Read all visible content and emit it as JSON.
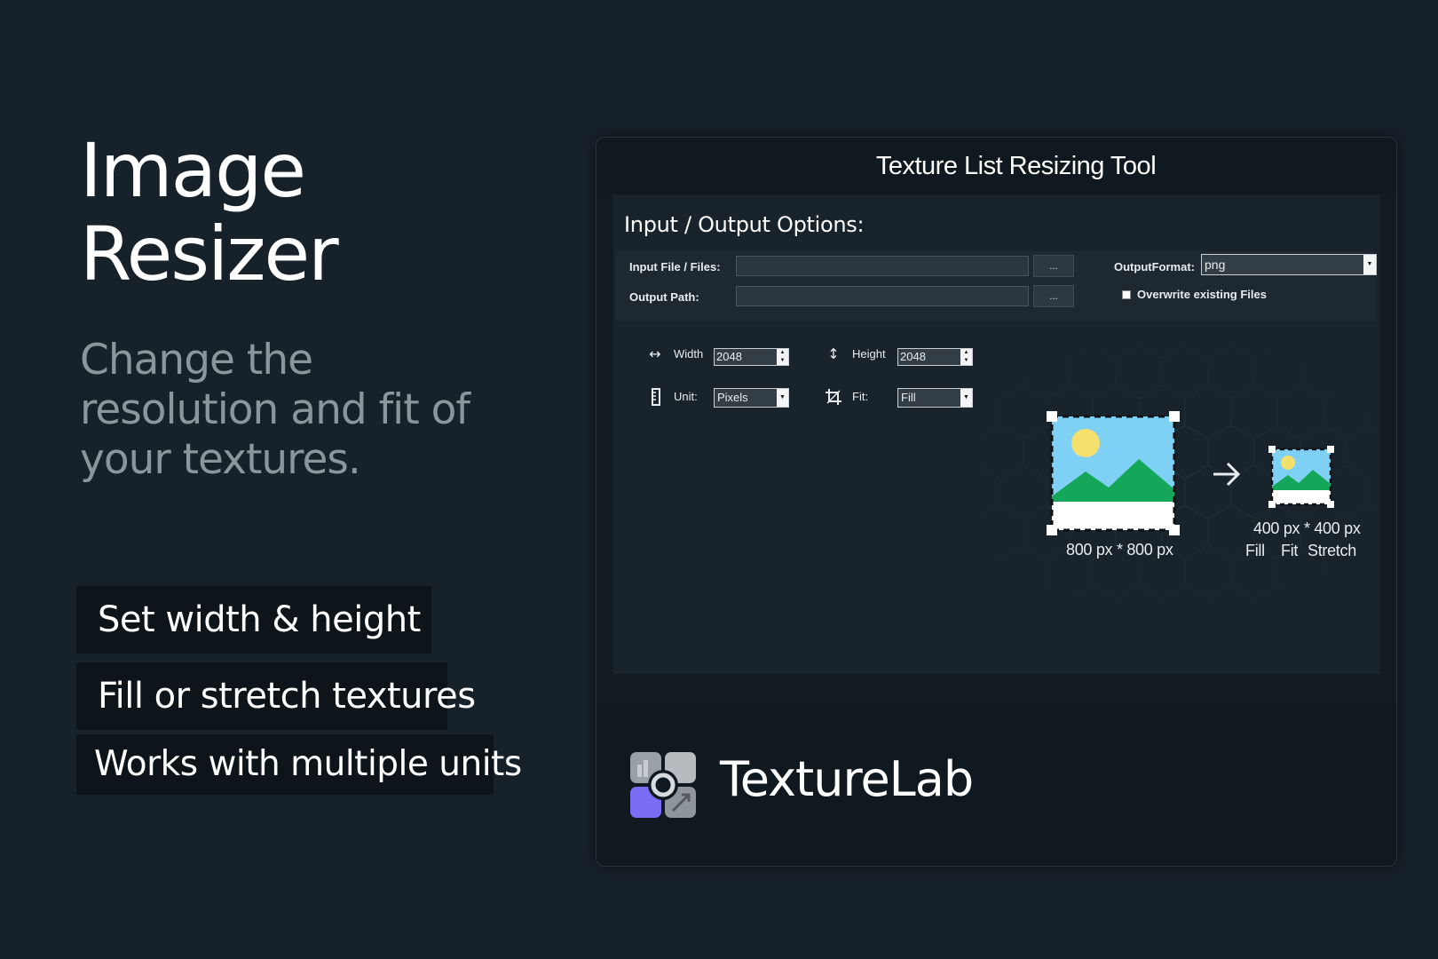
{
  "hero": {
    "title_line1": "Image",
    "title_line2": "Resizer",
    "subtitle": "Change the resolution and fit of your textures."
  },
  "features": [
    "Set width & height",
    "Fill or stretch textures",
    "Works with multiple units"
  ],
  "tool": {
    "window_title": "Texture List Resizing Tool",
    "section_title": "Input / Output Options:",
    "input_files_label": "Input File / Files:",
    "input_files_value": "",
    "output_path_label": "Output Path:",
    "output_path_value": "",
    "browse_label": "...",
    "output_format_label": "OutputFormat:",
    "output_format_value": "png",
    "overwrite_label": "Overwrite existing Files",
    "overwrite_checked": false,
    "width_label": "Width",
    "width_value": "2048",
    "height_label": "Height",
    "height_value": "2048",
    "unit_label": "Unit:",
    "unit_value": "Pixels",
    "fit_label": "Fit:",
    "fit_value": "Fill"
  },
  "illustration": {
    "source_size": "800 px * 800 px",
    "target_size": "400 px * 400 px",
    "modes": [
      "Fill",
      "Fit",
      "Stretch"
    ]
  },
  "brand": {
    "name": "TextureLab",
    "colors": {
      "accent": "#7b6cf6",
      "grass": "#14a659",
      "sky": "#7fd0f5",
      "sun": "#f5e06e"
    }
  },
  "icons": {
    "width": "horizontal-arrows-icon",
    "height": "vertical-arrows-icon",
    "unit": "ruler-icon",
    "fit": "crop-icon",
    "arrow": "arrow-right-icon"
  }
}
